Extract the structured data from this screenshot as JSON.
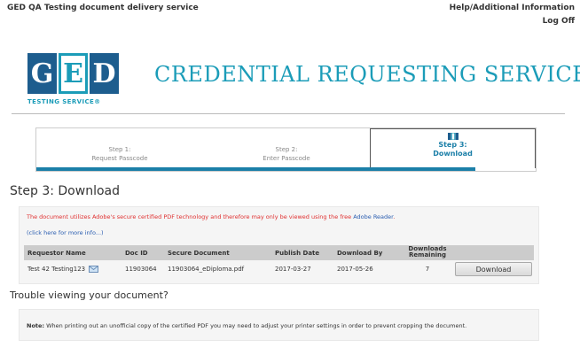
{
  "header": {
    "site_name": "GED QA Testing document delivery service",
    "help_link": "Help/Additional Information",
    "logoff_link": "Log Off"
  },
  "logo": {
    "letters": [
      "G",
      "E",
      "D"
    ],
    "subtitle": "TESTING SERVICE®"
  },
  "page_title": "CREDENTIAL REQUESTING SERVICE",
  "steps": [
    {
      "line1": "Step 1:",
      "line2": "Request Passcode"
    },
    {
      "line1": "Step 2:",
      "line2": "Enter Passcode"
    },
    {
      "line1": "Step 3:",
      "line2": "Download"
    }
  ],
  "progress_fraction": 0.88,
  "section_heading": "Step 3: Download",
  "notice": {
    "text": "The document utilizes Adobe's secure certified PDF technology and therefore may only be viewed using the free ",
    "link": "Adobe Reader",
    "end": ".",
    "more_info": "(click here for more info...)"
  },
  "table": {
    "headers": {
      "requestor": "Requestor Name",
      "doc_id": "Doc ID",
      "secure_doc": "Secure Document",
      "publish": "Publish Date",
      "download_by": "Download By",
      "remaining_1": "Downloads",
      "remaining_2": "Remaining"
    },
    "row": {
      "requestor": "Test 42 Testing123",
      "doc_id": "11903064",
      "secure_doc": "11903064_eDiploma.pdf",
      "publish": "2017-03-27",
      "download_by": "2017-05-26",
      "remaining": "7",
      "button": "Download"
    }
  },
  "trouble_heading": "Trouble viewing your document?",
  "note": {
    "label": "Note:",
    "text": " When printing out an unofficial copy of the certified PDF you may need to adjust your printer settings in order to prevent cropping the document."
  },
  "colors": {
    "accent": "#1b9cb8",
    "logo_blue": "#1d5d8e",
    "progress": "#1b7fa8",
    "notice_red": "#e03030",
    "link_blue": "#2a5db0"
  }
}
